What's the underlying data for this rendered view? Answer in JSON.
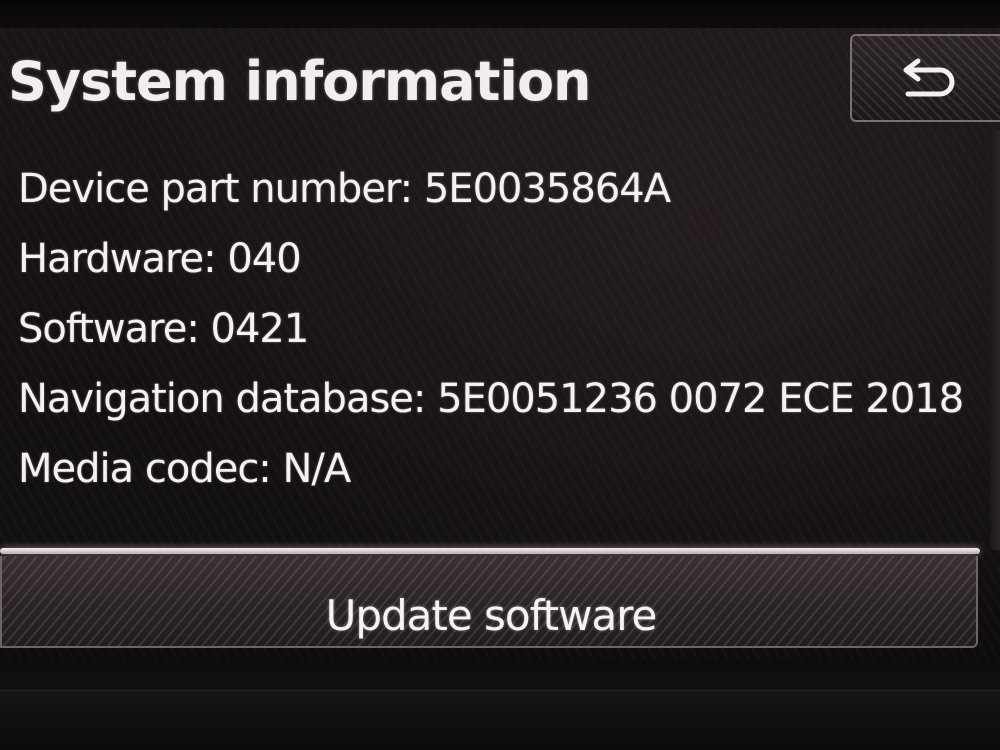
{
  "header": {
    "title": "System information"
  },
  "back_button": {
    "icon": "back-arrow-icon"
  },
  "info": {
    "rows": [
      "Device part number: 5E0035864A",
      "Hardware: 040",
      "Software: 0421",
      "Navigation database: 5E0051236  0072 ECE 2018",
      "Media codec: N/A"
    ]
  },
  "footer": {
    "update_label": "Update software"
  },
  "colors": {
    "text": "#f4eeee",
    "background": "#151113",
    "button_border": "#7a6f72"
  }
}
